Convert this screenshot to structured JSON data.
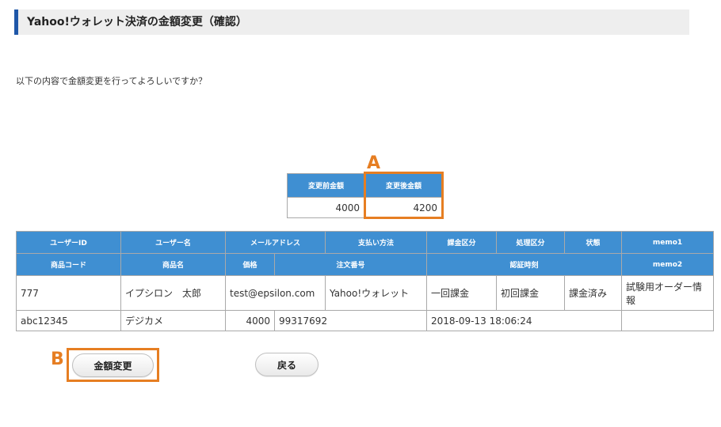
{
  "header": {
    "title": "Yahoo!ウォレット決済の金額変更（確認）"
  },
  "confirm_message": "以下の内容で金額変更を行ってよろしいですか？",
  "amount_table": {
    "headers": [
      "変更前金額",
      "変更後金額"
    ],
    "before": "4000",
    "after": "4200"
  },
  "main_table": {
    "header_row1": [
      "ユーザーID",
      "ユーザー名",
      "メールアドレス",
      "支払い方法",
      "課金区分",
      "処理区分",
      "状態",
      "memo1"
    ],
    "header_row2": [
      "商品コード",
      "商品名",
      "価格",
      "注文番号",
      "認証時刻",
      "memo2"
    ],
    "row1": [
      "777",
      "イプシロン　太郎",
      "test@epsilon.com",
      "Yahoo!ウォレット",
      "一回課金",
      "初回課金",
      "課金済み",
      "試験用オーダー情報"
    ],
    "row2": [
      "abc12345",
      "デジカメ",
      "4000",
      "99317692",
      "2018-09-13 18:06:24",
      ""
    ]
  },
  "annotations": {
    "a": "A",
    "b": "B"
  },
  "buttons": {
    "change": "金額変更",
    "back": "戻る"
  },
  "colors": {
    "header_accent": "#1f57a8",
    "table_header": "#3f8fd2",
    "highlight": "#e67e22"
  }
}
